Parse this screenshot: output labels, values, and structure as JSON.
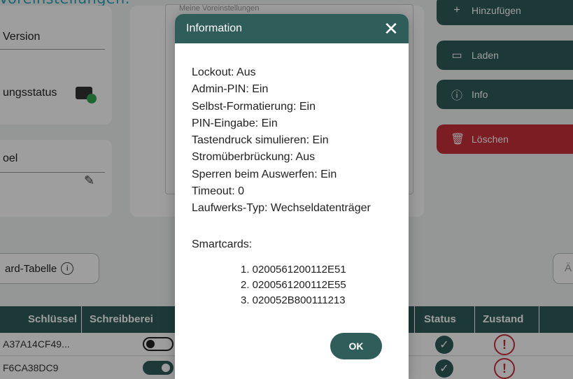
{
  "app": {
    "heading": "Voreinstellungen:",
    "fields": {
      "version_label": "Version",
      "status_label": "ungsstatus",
      "label_label": "oel"
    },
    "textarea_placeholder": "Meine Voreinstellungen",
    "side_buttons": {
      "add": "Hinzufügen",
      "load": "Laden",
      "info": "Info",
      "delete": "Löschen"
    },
    "section_button": "ard-Tabelle",
    "right_partial": "Ä",
    "table": {
      "headers": {
        "key": "Schlüssel",
        "write": "Schreibberei",
        "status": "Status",
        "state": "Zustand"
      },
      "rows": [
        {
          "key": "A37A14CF49...",
          "toggle": false
        },
        {
          "key": "F6CA38DC9",
          "toggle": true
        }
      ]
    }
  },
  "dialog": {
    "title": "Information",
    "lines": [
      "Lockout: Aus",
      "Admin-PIN: Ein",
      "Selbst-Formatierung: Ein",
      "PIN-Eingabe: Ein",
      "Tastendruck simulieren: Ein",
      "Stromüberbrückung: Aus",
      "Sperren beim Auswerfen: Ein",
      "Timeout: 0",
      "Laufwerks-Typ: Wechseldatenträger"
    ],
    "smartcards_title": "Smartcards:",
    "smartcards": [
      "1. 0200561200112E51",
      "2. 0200561200112E55",
      "3. 020052B800111213"
    ],
    "ok_label": "OK"
  },
  "colors": {
    "primary": "#2f5d5a",
    "danger": "#c9303b",
    "accent": "#2aa7b5"
  }
}
